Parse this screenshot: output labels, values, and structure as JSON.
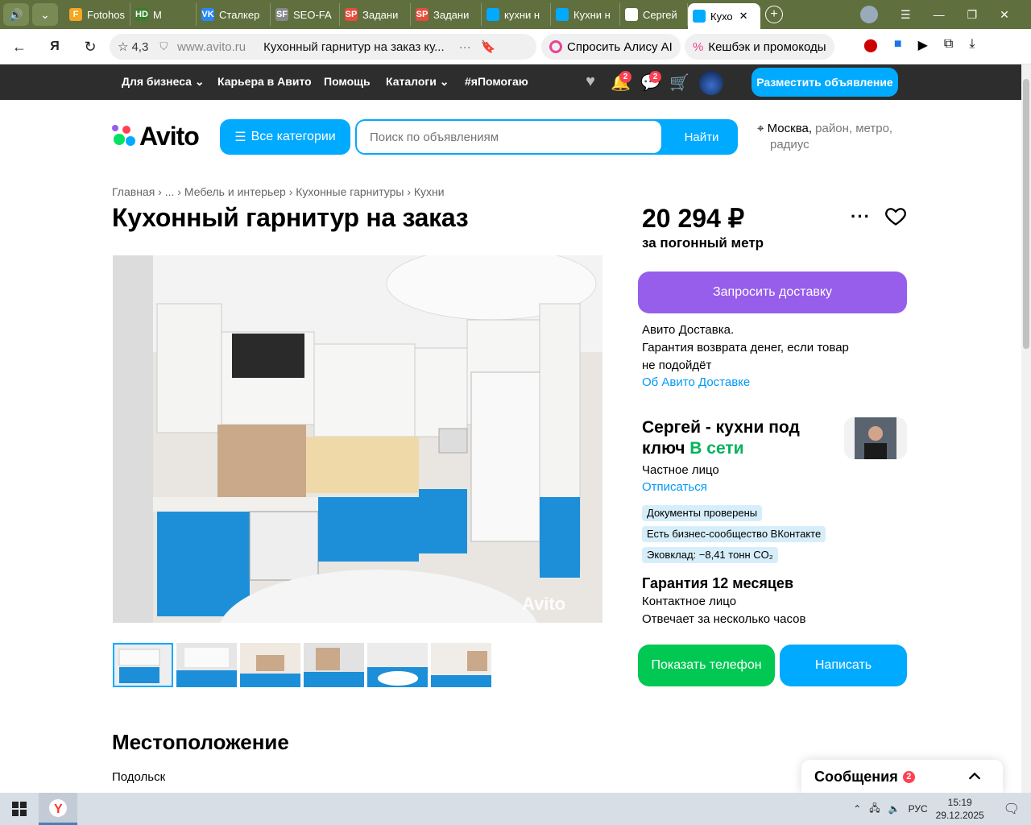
{
  "browser": {
    "tabs": [
      {
        "title": "Fotohos",
        "icon": "fotohost-favicon-icon",
        "color": "#f5a623",
        "glyph": "F"
      },
      {
        "title": "M",
        "icon": "hd-favicon-icon",
        "color": "#3a7d2c",
        "glyph": "HD"
      },
      {
        "title": "Сталкер",
        "icon": "vk-favicon-icon",
        "color": "#2787f5",
        "glyph": "VK"
      },
      {
        "title": "SEO-FA",
        "icon": "sf-favicon-icon",
        "color": "#888888",
        "glyph": "SF"
      },
      {
        "title": "Задани",
        "icon": "sp-favicon-icon",
        "color": "#e74c3c",
        "glyph": "SP"
      },
      {
        "title": "Задани",
        "icon": "sp-favicon-icon",
        "color": "#e74c3c",
        "glyph": "SP"
      },
      {
        "title": "кухни н",
        "icon": "avito-favicon-icon",
        "color": "#00aaff",
        "glyph": ""
      },
      {
        "title": "Кухни н",
        "icon": "avito-favicon-icon",
        "color": "#00aaff",
        "glyph": ""
      },
      {
        "title": "Сергей",
        "icon": "dot-favicon-icon",
        "color": "#ffffff",
        "glyph": "."
      },
      {
        "title": "Кухо",
        "icon": "avito-favicon-icon",
        "color": "#00aaff",
        "glyph": "",
        "active": true
      }
    ],
    "rating": "4,3",
    "url": "www.avito.ru",
    "page_title": "Кухонный гарнитур на заказ ку...",
    "alice_label": "Спросить Алису AI",
    "cashback_label": "Кешбэк и промокоды"
  },
  "topnav": {
    "links": [
      "Для бизнеса",
      "Карьера в Авито",
      "Помощь",
      "Каталоги",
      "#яПомогаю"
    ],
    "notif_count": "2",
    "msg_count": "2",
    "post_label": "Разместить объявление"
  },
  "search": {
    "logo": "Avito",
    "categories_label": "Все категории",
    "placeholder": "Поиск по объявлениям",
    "button": "Найти",
    "location_city": "Москва,",
    "location_rest": " район, метро,",
    "location_line2": "радиус"
  },
  "breadcrumbs": [
    "Главная",
    " › ",
    "...",
    " › ",
    "Мебель и интерьер",
    " › ",
    "Кухонные гарнитуры",
    " › ",
    "Кухни"
  ],
  "listing": {
    "title": "Кухонный гарнитур на заказ",
    "price": "20 294 ₽",
    "unit": "за погонный метр",
    "watermark": "Avito"
  },
  "delivery": {
    "button": "Запросить доставку",
    "line1": "Авито Доставка.",
    "line2": "Гарантия возврата денег, если товар",
    "line3": "не подойдёт",
    "link": "Об Авито Доставке"
  },
  "seller": {
    "name": "Сергей - кухни под ключ",
    "status": "В сети",
    "type": "Частное лицо",
    "unsubscribe": "Отписаться",
    "tags": [
      "Документы проверены",
      "Есть бизнес-сообщество ВКонтакте",
      "Эковклад: −8,41 тонн CO₂"
    ],
    "guarantee": "Гарантия 12 месяцев",
    "contact": "Контактное лицо",
    "response": "Отвечает за несколько часов",
    "phone_button": "Показать телефон",
    "write_button": "Написать"
  },
  "location_section": {
    "heading": "Местоположение",
    "city": "Подольск"
  },
  "messages_widget": {
    "label": "Сообщения",
    "count": "2"
  },
  "taskbar": {
    "lang": "РУС",
    "time": "15:19",
    "date": "29.12.2025"
  },
  "colors": {
    "avito_blue": "#00aaff",
    "delivery_purple": "#965eeb",
    "phone_green": "#00c853",
    "online_green": "#02b35a",
    "badge_red": "#ff4053"
  }
}
